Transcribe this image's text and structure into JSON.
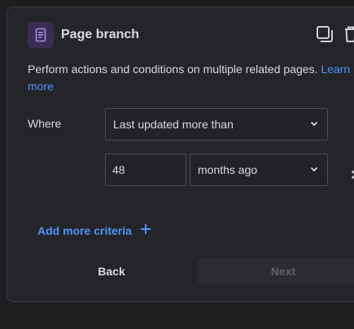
{
  "header": {
    "title": "Page branch",
    "icon": "page-icon",
    "accent": "#3a2d55"
  },
  "description": {
    "text": "Perform actions and conditions on multiple related pages.",
    "link_label_1": "Learn",
    "link_label_2": "more",
    "link_color": "#4c94ff"
  },
  "criteria": {
    "where_label": "Where",
    "condition_value": "Last updated more than",
    "amount_value": "48",
    "unit_value": "months ago"
  },
  "add_more": {
    "label": "Add more criteria"
  },
  "footer": {
    "back_label": "Back",
    "next_label": "Next"
  }
}
